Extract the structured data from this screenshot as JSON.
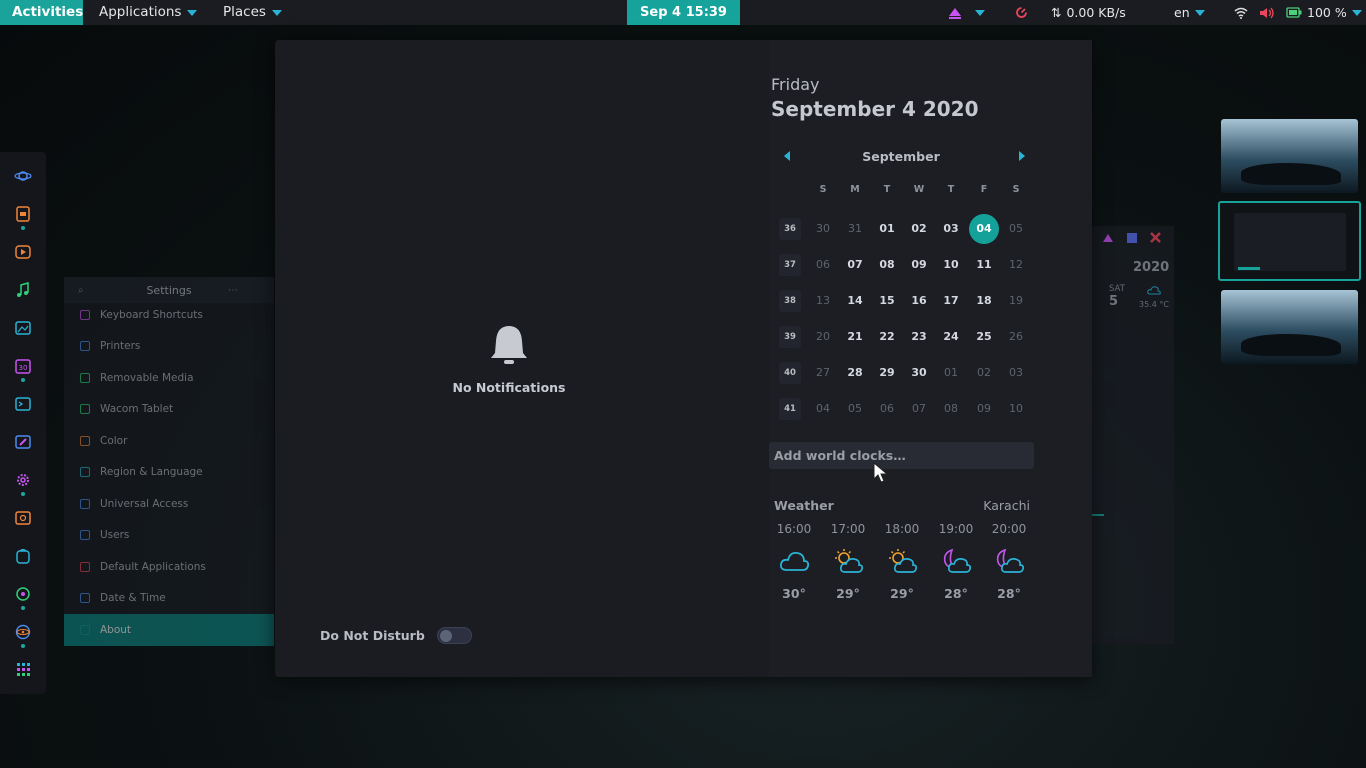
{
  "topbar": {
    "activities": "Activities",
    "applications": "Applications",
    "places": "Places",
    "clock": "Sep 4  15:39",
    "network_speed": "0.00 KB/s",
    "keyboard_layout": "en",
    "battery": "100 %"
  },
  "dock": {
    "icons": [
      "saturn-icon",
      "files-icon",
      "video-player-icon",
      "music-icon",
      "image-viewer-icon",
      "calendar-icon",
      "terminal-icon",
      "image-editor-icon",
      "settings-gear-icon",
      "screenshot-icon",
      "store-icon",
      "maps-icon",
      "atom-icon",
      "app-grid-icon"
    ]
  },
  "settings_window": {
    "title": "Settings",
    "items": [
      "Keyboard Shortcuts",
      "Printers",
      "Removable Media",
      "Wacom Tablet",
      "Color",
      "Region & Language",
      "Universal Access",
      "Users",
      "Default Applications",
      "Date & Time",
      "About"
    ],
    "active": "About"
  },
  "background_window": {
    "year": "2020",
    "day_label": "SAT",
    "day_number": "5",
    "temperature": "35.4 °C"
  },
  "notifications": {
    "empty_text": "No Notifications",
    "dnd_label": "Do Not Disturb",
    "dnd_enabled": false
  },
  "calendar": {
    "weekday": "Friday",
    "full_date": "September 4 2020",
    "month": "September",
    "dow": [
      "S",
      "M",
      "T",
      "W",
      "T",
      "F",
      "S"
    ],
    "weeks": [
      {
        "wk": "36",
        "days": [
          "30",
          "31",
          "01",
          "02",
          "03",
          "04",
          "05"
        ],
        "cur": [
          false,
          false,
          true,
          true,
          true,
          true,
          false
        ]
      },
      {
        "wk": "37",
        "days": [
          "06",
          "07",
          "08",
          "09",
          "10",
          "11",
          "12"
        ],
        "cur": [
          false,
          true,
          true,
          true,
          true,
          true,
          false
        ]
      },
      {
        "wk": "38",
        "days": [
          "13",
          "14",
          "15",
          "16",
          "17",
          "18",
          "19"
        ],
        "cur": [
          false,
          true,
          true,
          true,
          true,
          true,
          false
        ]
      },
      {
        "wk": "39",
        "days": [
          "20",
          "21",
          "22",
          "23",
          "24",
          "25",
          "26"
        ],
        "cur": [
          false,
          true,
          true,
          true,
          true,
          true,
          false
        ]
      },
      {
        "wk": "40",
        "days": [
          "27",
          "28",
          "29",
          "30",
          "01",
          "02",
          "03"
        ],
        "cur": [
          false,
          true,
          true,
          true,
          false,
          false,
          false
        ]
      },
      {
        "wk": "41",
        "days": [
          "04",
          "05",
          "06",
          "07",
          "08",
          "09",
          "10"
        ],
        "cur": [
          false,
          false,
          false,
          false,
          false,
          false,
          false
        ]
      }
    ],
    "today": "04",
    "world_clocks_placeholder": "Add world clocks…"
  },
  "weather": {
    "title": "Weather",
    "location": "Karachi",
    "forecast": [
      {
        "hour": "16:00",
        "icon": "cloud-icon",
        "temp": "30°"
      },
      {
        "hour": "17:00",
        "icon": "partly-sunny-icon",
        "temp": "29°"
      },
      {
        "hour": "18:00",
        "icon": "partly-sunny-icon",
        "temp": "29°"
      },
      {
        "hour": "19:00",
        "icon": "night-cloud-icon",
        "temp": "28°"
      },
      {
        "hour": "20:00",
        "icon": "night-cloud-icon",
        "temp": "28°"
      }
    ]
  },
  "colors": {
    "accent": "#16a39b",
    "nav_arrow": "#2bb3d6",
    "purple": "#c655ef",
    "red": "#e8465a"
  }
}
